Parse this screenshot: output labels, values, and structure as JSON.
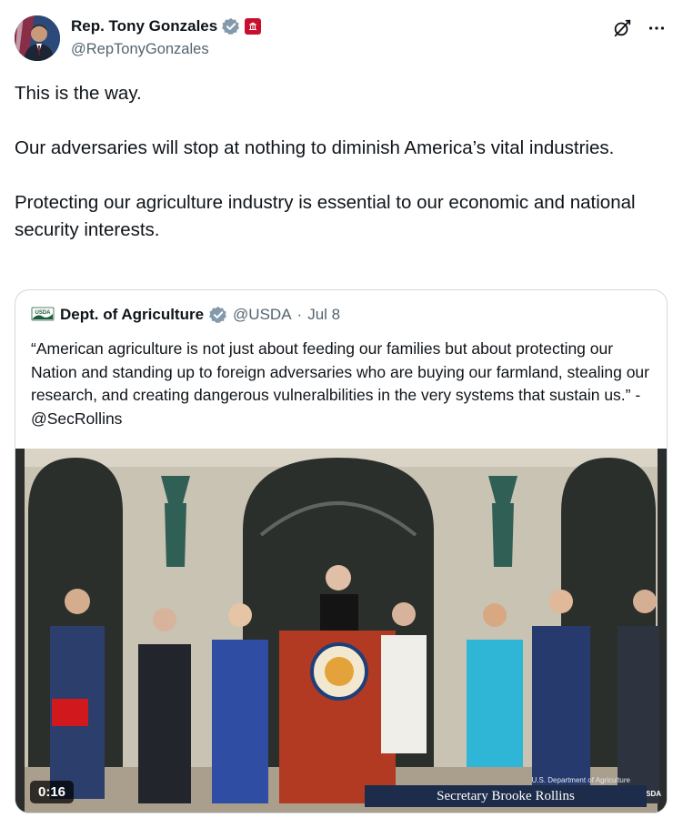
{
  "author": {
    "name": "Rep. Tony Gonzales",
    "handle": "@RepTonyGonzales"
  },
  "icons": {
    "grok": "grok-icon",
    "more": "more-icon",
    "verified": "verified-check-icon",
    "gov_badge": "us-house-badge-icon"
  },
  "tweet": {
    "paragraphs": [
      "This is the way.",
      "Our adversaries will stop at nothing to diminish America’s vital industries.",
      "Protecting our agriculture industry is essential to our economic and national security interests."
    ]
  },
  "quote": {
    "name": "Dept. of Agriculture",
    "handle": "@USDA",
    "separator": "·",
    "date": "Jul 8",
    "text": "“American agriculture is not just about feeding our families but about protecting our Nation and standing up to foreign adversaries who are buying our farmland, stealing our research, and creating dangerous vulneralbilities in the very systems that sustain us.” -@SecRollins",
    "logo_text": "USDA"
  },
  "video": {
    "duration": "0:16",
    "caption": "Secretary Brooke Rollins",
    "caption_small": "U.S. Department of Agriculture",
    "corner_tag": "USDA"
  },
  "colors": {
    "text": "#0f1419",
    "secondary": "#536471",
    "verified": "#829aab",
    "border": "#cfd9de",
    "gov_red": "#c8102e"
  }
}
